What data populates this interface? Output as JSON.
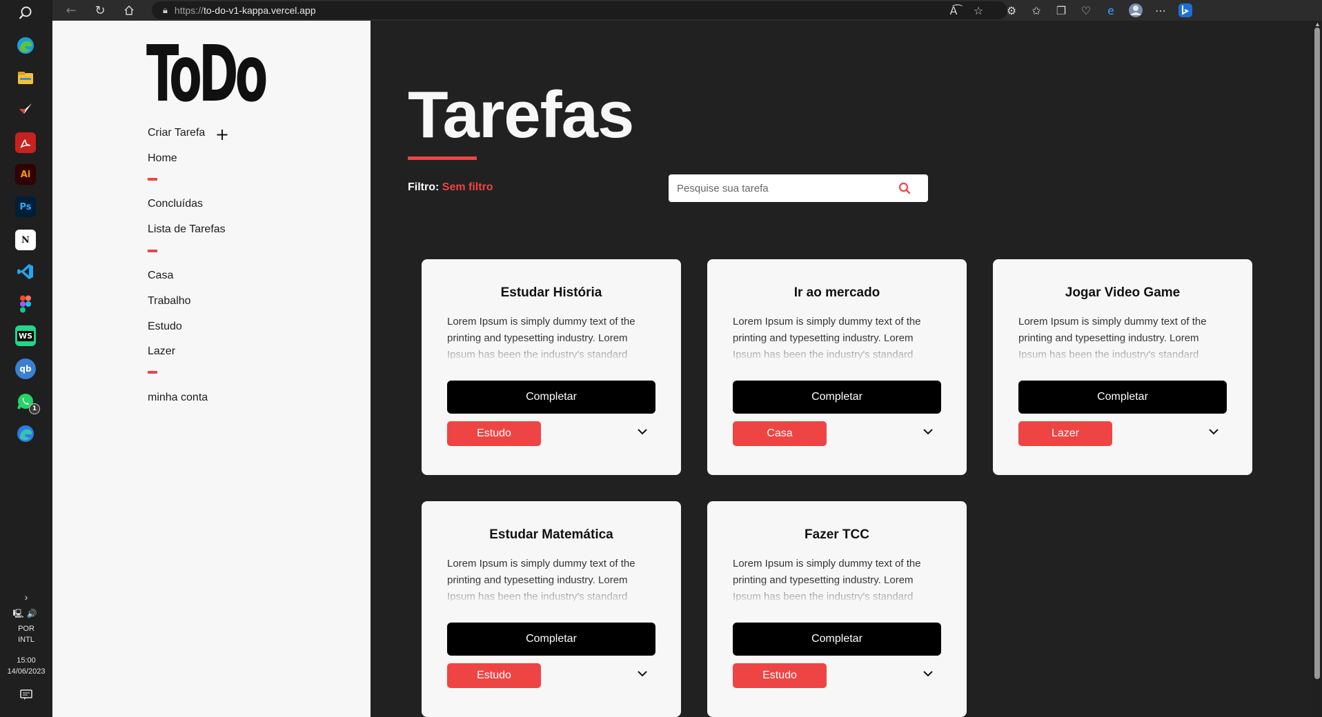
{
  "taskbar": {
    "icons": [
      "search-icon",
      "edge-icon",
      "file-explorer-icon",
      "app-icon",
      "acrobat-icon",
      "illustrator-icon",
      "photoshop-icon",
      "notion-icon",
      "vscode-icon",
      "figma-icon",
      "webstorm-icon",
      "qbittorrent-icon",
      "whatsapp-icon",
      "edge-dev-icon"
    ],
    "illustrator_label": "Ai",
    "photoshop_label": "Ps",
    "notion_label": "N",
    "webstorm_label": "WS",
    "qbittorrent_label": "qb",
    "whatsapp_badge": "1",
    "language": "POR",
    "layout": "INTL",
    "time": "15:00",
    "date": "14/06/2023"
  },
  "browser": {
    "url_scheme": "https://",
    "url_host": "to-do-v1-kappa.vercel.app"
  },
  "sidebar": {
    "logo": "ToDo",
    "create_task": "Criar Tarefa",
    "items": {
      "home": "Home",
      "completed": "Concluídas",
      "task_list": "Lista de Tarefas",
      "home_category": "Casa",
      "work": "Trabalho",
      "study": "Estudo",
      "leisure": "Lazer",
      "account": "minha conta"
    }
  },
  "main": {
    "title": "Tarefas",
    "filter_label": "Filtro:",
    "filter_value": "Sem filtro",
    "search_placeholder": "Pesquise sua tarefa"
  },
  "tasks": [
    {
      "title": "Estudar História",
      "description": "Lorem Ipsum is simply dummy text of the printing and typesetting industry. Lorem Ipsum has been the industry's standard",
      "action": "Completar",
      "category": "Estudo"
    },
    {
      "title": "Ir ao mercado",
      "description": "Lorem Ipsum is simply dummy text of the printing and typesetting industry. Lorem Ipsum has been the industry's standard",
      "action": "Completar",
      "category": "Casa"
    },
    {
      "title": "Jogar Video Game",
      "description": "Lorem Ipsum is simply dummy text of the printing and typesetting industry. Lorem Ipsum has been the industry's standard",
      "action": "Completar",
      "category": "Lazer"
    },
    {
      "title": "Estudar Matemática",
      "description": "Lorem Ipsum is simply dummy text of the printing and typesetting industry. Lorem Ipsum has been the industry's standard",
      "action": "Completar",
      "category": "Estudo"
    },
    {
      "title": "Fazer TCC",
      "description": "Lorem Ipsum is simply dummy text of the printing and typesetting industry. Lorem Ipsum has been the industry's standard",
      "action": "Completar",
      "category": "Estudo"
    }
  ],
  "colors": {
    "accent": "#ef4444",
    "sidebar_bg": "#f7f7f7",
    "main_bg": "#212121",
    "card_bg": "#f7f7f7",
    "button_bg": "#000000"
  }
}
